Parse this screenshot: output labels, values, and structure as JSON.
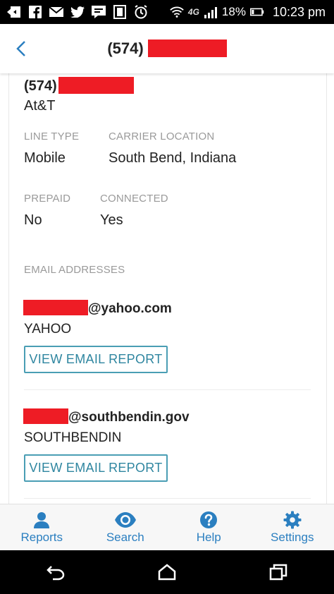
{
  "status_bar": {
    "network": "4G",
    "battery": "18%",
    "time": "10:23 pm"
  },
  "header": {
    "title_prefix": "(574)"
  },
  "phone": {
    "prefix": "(574)",
    "carrier": "At&T"
  },
  "details": [
    {
      "label": "LINE TYPE",
      "value": "Mobile"
    },
    {
      "label": "CARRIER LOCATION",
      "value": "South Bend, Indiana"
    },
    {
      "label": "PREPAID",
      "value": "No"
    },
    {
      "label": "CONNECTED",
      "value": "Yes"
    }
  ],
  "emails_label": "EMAIL ADDRESSES",
  "emails": [
    {
      "domain": "@yahoo.com",
      "provider": "YAHOO",
      "button": "VIEW EMAIL REPORT"
    },
    {
      "domain": "@southbendin.gov",
      "provider": "SOUTHBENDIN",
      "button": "VIEW EMAIL REPORT"
    }
  ],
  "bottom_nav": [
    {
      "label": "Reports",
      "icon": "person-icon"
    },
    {
      "label": "Search",
      "icon": "eye-icon"
    },
    {
      "label": "Help",
      "icon": "help-icon"
    },
    {
      "label": "Settings",
      "icon": "gear-icon"
    }
  ],
  "colors": {
    "accent": "#2b7fc0",
    "button_border": "#4a9eb4",
    "redaction": "#ee1c25"
  }
}
